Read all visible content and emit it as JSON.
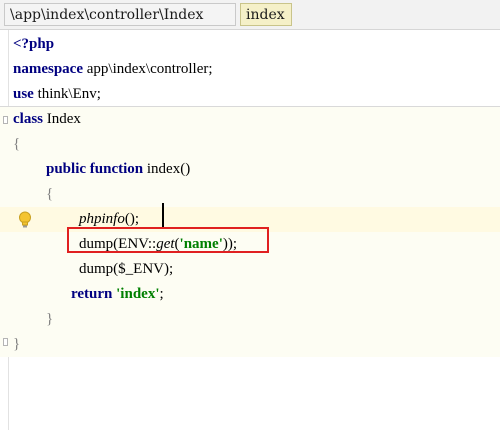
{
  "breadcrumb": {
    "path": "\\app\\index\\controller\\Index",
    "active": "index"
  },
  "code": {
    "l1_open_tag": "<?php",
    "l2_kw": "namespace",
    "l2_rest": " app\\index\\controller;",
    "l3_kw": "use",
    "l3_rest": " think\\Env;",
    "l4_kw": "class",
    "l4_rest": " Index",
    "l5_brace": "{",
    "l6_kw1": "public",
    "l6_kw2": "function",
    "l6_rest": " index()",
    "l7_brace": "{",
    "l8_fn": "phpinfo",
    "l8_rest": "();",
    "l9_a": "dump(ENV::",
    "l9_get": "get",
    "l9_b": "(",
    "l9_str": "'name'",
    "l9_c": "));",
    "l10": "dump($_ENV);",
    "l11_kw": "return",
    "l11_str": "'index'",
    "l11_end": ";",
    "l12_brace": "}",
    "l13_brace": "}"
  },
  "icons": {
    "intention": "lightbulb-icon",
    "fold": "fold-marker-icon"
  },
  "colors": {
    "keyword": "#000080",
    "string": "#008000",
    "highlight_border": "#e02020",
    "current_line": "#fffae2"
  }
}
